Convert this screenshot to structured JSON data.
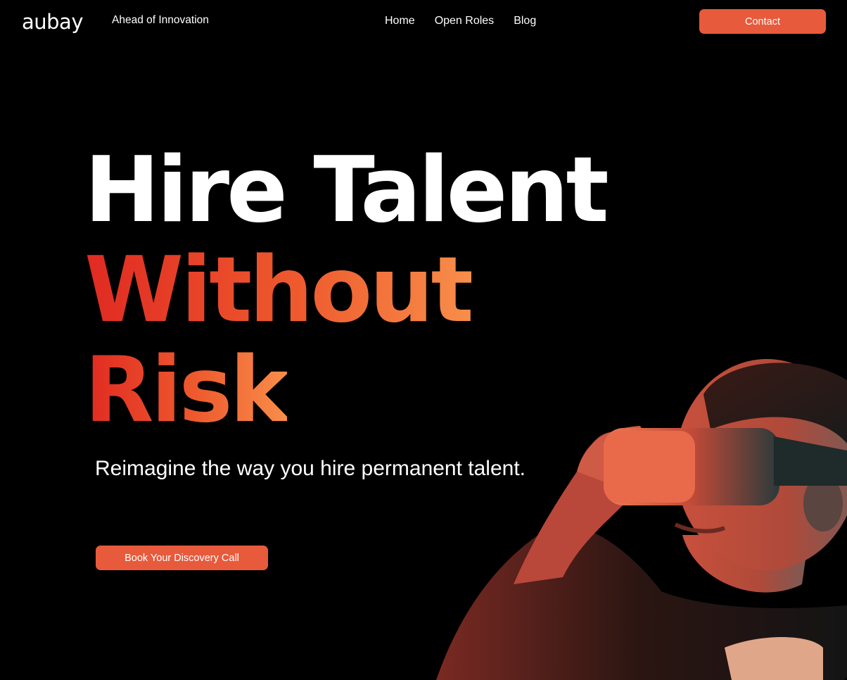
{
  "header": {
    "logo_text": "aubay",
    "tagline": "Ahead of Innovation",
    "nav": [
      {
        "label": "Home"
      },
      {
        "label": "Open Roles"
      },
      {
        "label": "Blog"
      }
    ],
    "contact_label": "Contact"
  },
  "hero": {
    "headline_line1": "Hire Talent",
    "headline_line2": "Without",
    "headline_line3": "Risk",
    "subtitle": "Reimagine the way you hire permanent talent.",
    "cta_label": "Book Your Discovery Call",
    "image": "person-wearing-vr-headset-photo"
  },
  "colors": {
    "background": "#000000",
    "accent": "#e85a3c",
    "gradient_start": "#e02a22",
    "gradient_end": "#f88e4a",
    "text": "#ffffff"
  }
}
